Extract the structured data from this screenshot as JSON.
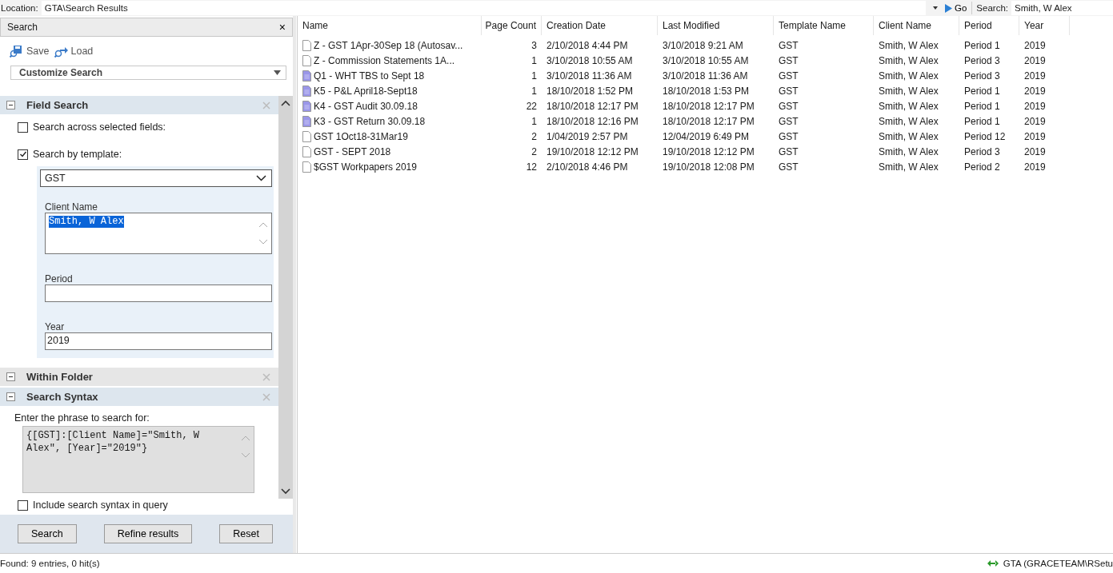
{
  "location_bar": {
    "label": "Location:",
    "path": "GTA\\Search Results",
    "go": "Go",
    "search_label": "Search:",
    "search_value": "Smith, W Alex"
  },
  "search_panel": {
    "title": "Search",
    "close": "×",
    "save": "Save",
    "load": "Load",
    "customize": "Customize Search",
    "field_search": {
      "title": "Field Search",
      "across_fields": {
        "label": "Search across selected fields:",
        "checked": false
      },
      "by_template": {
        "label": "Search by template:",
        "checked": true
      },
      "template": "GST",
      "fields": [
        {
          "label": "Client Name",
          "value": "Smith, W Alex",
          "kind": "multiline",
          "highlighted": true
        },
        {
          "label": "Period",
          "kind": "single"
        },
        {
          "label": "Year",
          "value": "2019",
          "kind": "single"
        }
      ]
    },
    "within_folder": {
      "title": "Within Folder"
    },
    "search_syntax": {
      "title": "Search Syntax",
      "prompt": "Enter the phrase to search for:",
      "syntax": "{[GST]:[Client Name]=\"Smith, W Alex\", [Year]=\"2019\"}",
      "include": {
        "label": "Include search syntax in query",
        "checked": false
      }
    },
    "buttons": [
      "Search",
      "Refine results",
      "Reset"
    ]
  },
  "table": {
    "columns": [
      "Name",
      "Page Count",
      "Creation Date",
      "Last Modified",
      "Template Name",
      "Client Name",
      "Period",
      "Year"
    ],
    "rows": [
      {
        "kind": "plain",
        "cells": [
          "Z - GST 1Apr-30Sep 18 (Autosav...",
          "3",
          "2/10/2018 4:44 PM",
          "3/10/2018 9:21 AM",
          "GST",
          "Smith, W Alex",
          "Period 1",
          "2019"
        ]
      },
      {
        "kind": "plain",
        "cells": [
          "Z - Commission Statements 1A...",
          "1",
          "3/10/2018 10:55 AM",
          "3/10/2018 10:55 AM",
          "GST",
          "Smith, W Alex",
          "Period 3",
          "2019"
        ]
      },
      {
        "kind": "doc",
        "cells": [
          "Q1 - WHT TBS to Sept 18",
          "1",
          "3/10/2018 11:36 AM",
          "3/10/2018 11:36 AM",
          "GST",
          "Smith, W Alex",
          "Period 3",
          "2019"
        ]
      },
      {
        "kind": "doc",
        "cells": [
          "K5 - P&L April18-Sept18",
          "1",
          "18/10/2018 1:52 PM",
          "18/10/2018 1:53 PM",
          "GST",
          "Smith, W Alex",
          "Period 1",
          "2019"
        ]
      },
      {
        "kind": "doc",
        "cells": [
          "K4 - GST Audit 30.09.18",
          "22",
          "18/10/2018 12:17 PM",
          "18/10/2018 12:17 PM",
          "GST",
          "Smith, W Alex",
          "Period 1",
          "2019"
        ]
      },
      {
        "kind": "doc",
        "cells": [
          "K3 - GST Return 30.09.18",
          "1",
          "18/10/2018 12:16 PM",
          "18/10/2018 12:17 PM",
          "GST",
          "Smith, W Alex",
          "Period 1",
          "2019"
        ]
      },
      {
        "kind": "plain",
        "cells": [
          "GST 1Oct18-31Mar19",
          "2",
          "1/04/2019 2:57 PM",
          "12/04/2019 6:49 PM",
          "GST",
          "Smith, W Alex",
          "Period 12",
          "2019"
        ]
      },
      {
        "kind": "plain",
        "cells": [
          "GST - SEPT 2018",
          "2",
          "19/10/2018 12:12 PM",
          "19/10/2018 12:12 PM",
          "GST",
          "Smith, W Alex",
          "Period 3",
          "2019"
        ]
      },
      {
        "kind": "plain",
        "cells": [
          "$GST Workpapers 2019",
          "12",
          "2/10/2018 4:46 PM",
          "19/10/2018 12:08 PM",
          "GST",
          "Smith, W Alex",
          "Period 2",
          "2019"
        ]
      }
    ]
  },
  "status_bar": {
    "found": "Found: 9 entries, 0 hit(s)",
    "connection": "GTA (GRACETEAM\\RSetu"
  }
}
